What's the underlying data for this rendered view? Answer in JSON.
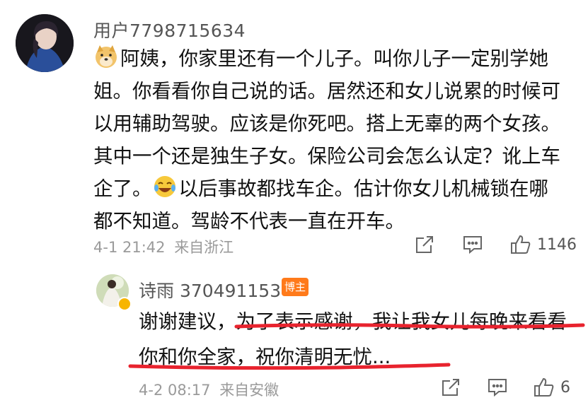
{
  "comment": {
    "username": "用户7798715634",
    "emoji_1": "doge-emoji",
    "text_part1": "阿姨，你家里还有一个儿子。叫你儿子一定别学她姐。你看看你自己说的话。居然还和女儿说累的时候可以用辅助驾驶。应该是你死吧。搭上无辜的两个女孩。其中一个还是独生子女。保险公司会怎么认定？讹上车企了。",
    "emoji_2": "laugh-cry-emoji",
    "text_part2": "以后事故都找车企。估计你女儿机械锁在哪都不知道。驾龄不代表一直在开车。",
    "time": "4-1 21:42",
    "location": "来自浙江",
    "likes": "1146"
  },
  "reply": {
    "username": "诗雨 370491153",
    "badge": "博主",
    "text": "谢谢建议，为了表示感谢，我让我女儿每晚来看看你和你全家，祝你清明无忧...",
    "time": "4-2 08:17",
    "location": "来自安徽",
    "likes": "6"
  },
  "colors": {
    "underline": "#e8232e",
    "badge": "#ff7a1a",
    "meta": "#9a9a9a"
  }
}
